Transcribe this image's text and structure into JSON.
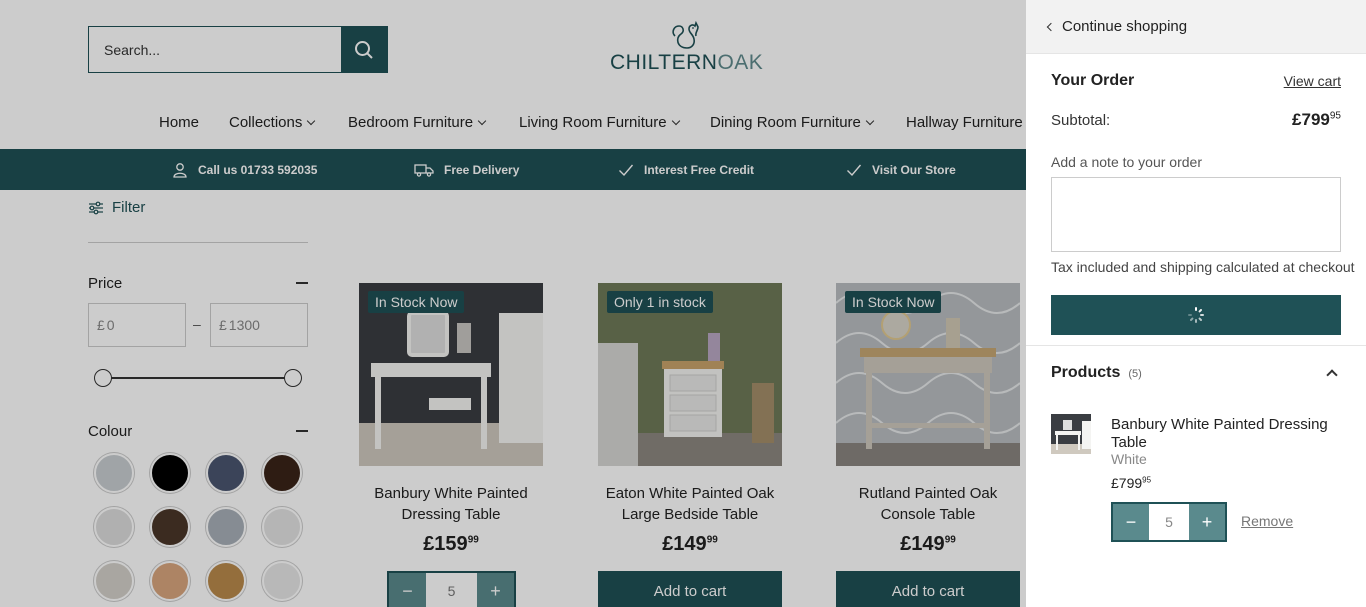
{
  "header": {
    "search_placeholder": "Search...",
    "logo_main": "CHILTERN",
    "logo_accent": "OAK"
  },
  "nav": [
    {
      "label": "Home"
    },
    {
      "label": "Collections"
    },
    {
      "label": "Bedroom Furniture"
    },
    {
      "label": "Living Room Furniture"
    },
    {
      "label": "Dining Room Furniture"
    },
    {
      "label": "Hallway Furniture"
    }
  ],
  "usp": [
    {
      "label": "Call us 01733 592035",
      "icon": "user-icon"
    },
    {
      "label": "Free Delivery",
      "icon": "truck-icon"
    },
    {
      "label": "Interest Free Credit",
      "icon": "check-icon"
    },
    {
      "label": "Visit Our Store",
      "icon": "check-icon"
    }
  ],
  "filters": {
    "filter_label": "Filter",
    "price_title": "Price",
    "currency": "£",
    "price_min": "0",
    "price_max": "1300",
    "colour_title": "Colour",
    "swatches": [
      "#c8cdd1",
      "#000000",
      "#4a5670",
      "#3a2418",
      "#dcdcdc",
      "#4a3628",
      "#a8b0b8",
      "#e3e3e3",
      "#d4d0ca",
      "#d9a67d",
      "#b98a4c",
      "#e6e6e6"
    ]
  },
  "products": [
    {
      "badge": "In Stock Now",
      "title": "Banbury White Painted Dressing Table",
      "price": "£159",
      "pence": "99",
      "qty": "5"
    },
    {
      "badge": "Only 1 in stock",
      "title": "Eaton White Painted Oak Large Bedside Table",
      "price": "£149",
      "pence": "99",
      "button": "Add to cart"
    },
    {
      "badge": "In Stock Now",
      "title": "Rutland Painted Oak Console Table",
      "price": "£149",
      "pence": "99",
      "button": "Add to cart"
    }
  ],
  "cart": {
    "continue": "Continue shopping",
    "your_order": "Your Order",
    "view_cart": "View cart",
    "subtotal_label": "Subtotal:",
    "subtotal": "£799",
    "subtotal_pence": "95",
    "note_label": "Add a note to your order",
    "tax_note": "Tax included and shipping calculated at checkout",
    "products_label": "Products",
    "products_count": "(5)",
    "line": {
      "title": "Banbury White Painted Dressing Table",
      "variant": "White",
      "price": "£799",
      "pence": "95",
      "qty": "5",
      "remove": "Remove"
    }
  },
  "colors": {
    "brand": "#1f5156",
    "button_light": "#5a8a8d"
  }
}
